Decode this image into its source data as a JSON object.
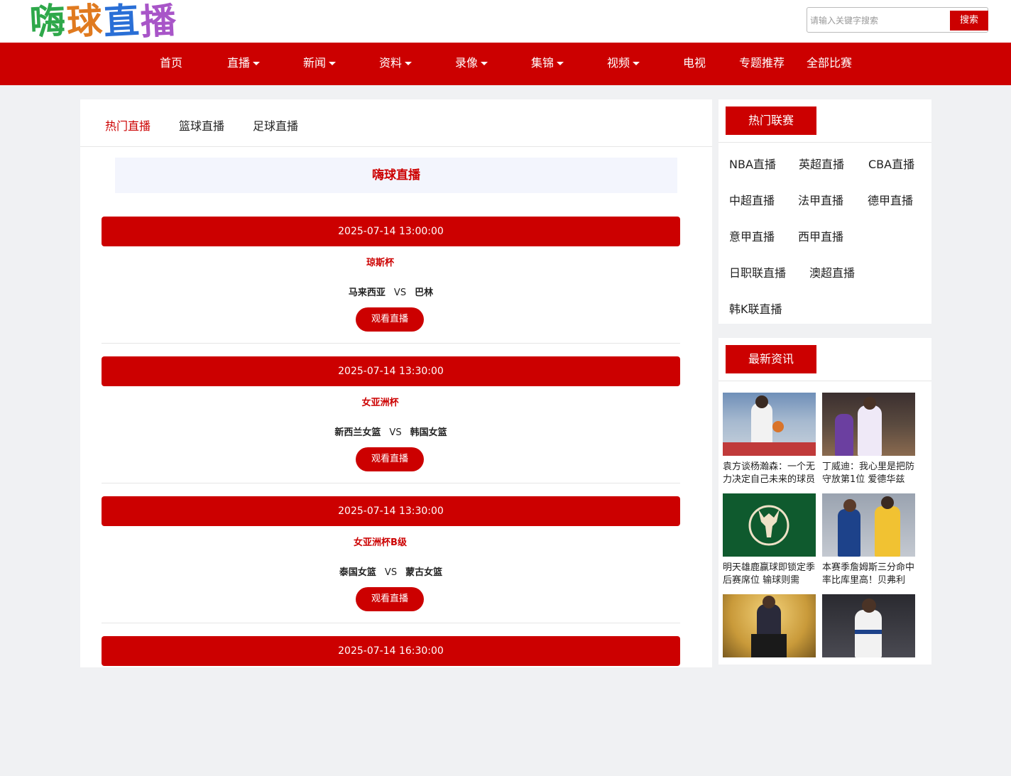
{
  "header": {
    "logo_chars": [
      "嗨",
      "球",
      "直",
      "播"
    ],
    "logo_colors": [
      "#2ea84a",
      "#e07a1f",
      "#2a6fd6",
      "#a855c8"
    ],
    "search_placeholder": "请输入关键字搜索",
    "search_button": "搜索"
  },
  "nav": [
    {
      "label": "首页",
      "dropdown": false
    },
    {
      "label": "直播",
      "dropdown": true
    },
    {
      "label": "新闻",
      "dropdown": true
    },
    {
      "label": "资料",
      "dropdown": true
    },
    {
      "label": "录像",
      "dropdown": true
    },
    {
      "label": "集锦",
      "dropdown": true
    },
    {
      "label": "视频",
      "dropdown": true
    },
    {
      "label": "电视",
      "dropdown": false
    },
    {
      "label": "专题推荐",
      "dropdown": false
    },
    {
      "label": "全部比赛",
      "dropdown": false
    }
  ],
  "tabs": [
    "热门直播",
    "篮球直播",
    "足球直播"
  ],
  "banner_title": "嗨球直播",
  "matches": [
    {
      "time": "2025-07-14 13:00:00",
      "league": "琼斯杯",
      "home": "马来西亚",
      "away": "巴林",
      "button": "观看直播"
    },
    {
      "time": "2025-07-14 13:30:00",
      "league": "女亚洲杯",
      "home": "新西兰女篮",
      "away": "韩国女篮",
      "button": "观看直播"
    },
    {
      "time": "2025-07-14 13:30:00",
      "league": "女亚洲杯B级",
      "home": "泰国女篮",
      "away": "蒙古女篮",
      "button": "观看直播"
    },
    {
      "time": "2025-07-14 16:30:00",
      "league": "",
      "home": "",
      "away": "",
      "button": ""
    }
  ],
  "vs_label": "VS",
  "hot_leagues": {
    "title": "热门联赛",
    "items": [
      "NBA直播",
      "英超直播",
      "CBA直播",
      "中超直播",
      "法甲直播",
      "德甲直播",
      "意甲直播",
      "西甲直播",
      "日职联直播",
      "澳超直播",
      "韩K联直播"
    ]
  },
  "latest_news": {
    "title": "最新资讯",
    "items": [
      {
        "title": "袁方谈杨瀚森：一个无力决定自己未来的球员",
        "image": "basketball-player-photo"
      },
      {
        "title": "丁威迪：我心里是把防守放第1位 爱德华兹",
        "image": "basketball-game-photo"
      },
      {
        "title": "明天雄鹿赢球即锁定季后赛席位 输球则需",
        "image": "milwaukee-bucks-logo"
      },
      {
        "title": "本赛季詹姆斯三分命中率比库里高！贝弗利",
        "image": "curry-lebron-photo"
      },
      {
        "title": "",
        "image": "podium-speaker-photo"
      },
      {
        "title": "",
        "image": "warriors-player-photo"
      }
    ]
  },
  "colors": {
    "brand_red": "#cc0000",
    "banner_bg": "#f3f5fd",
    "page_bg": "#f0f1f3"
  }
}
